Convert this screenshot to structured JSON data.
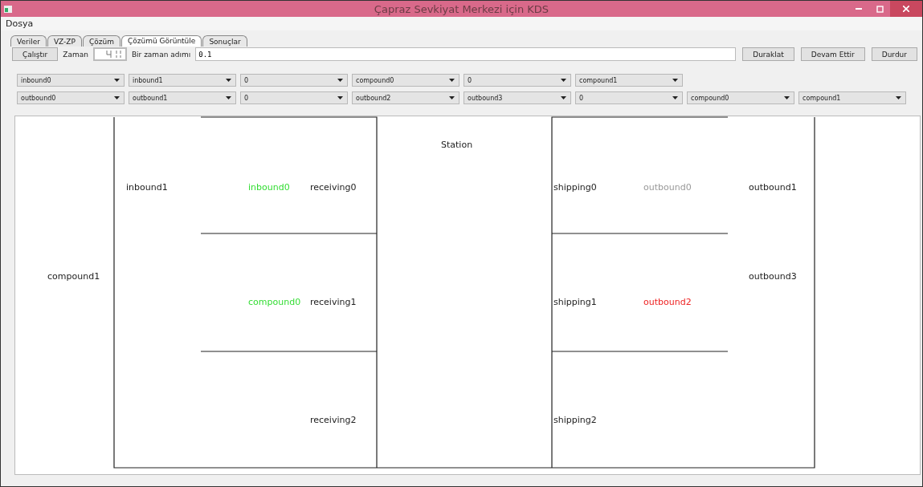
{
  "window": {
    "title": "Çapraz Sevkiyat Merkezi için KDS"
  },
  "menu": [
    "Dosya"
  ],
  "tabs": [
    {
      "label": "Veriler",
      "selected": false
    },
    {
      "label": "VZ-ZP",
      "selected": false
    },
    {
      "label": "Çözüm",
      "selected": false
    },
    {
      "label": "Çözümü Görüntüle",
      "selected": true
    },
    {
      "label": "Sonuçlar",
      "selected": false
    }
  ],
  "controls": {
    "run_button": "Çalıştır",
    "time_label": "Zaman",
    "step_label": "Bir zaman adımı",
    "step_value": "0.1",
    "buttons": [
      "Duraklat",
      "Devam Ettir",
      "Durdur"
    ]
  },
  "dropdown_rows": [
    [
      "inbound0",
      "inbound1",
      "0",
      "compound0",
      "0",
      "compound1"
    ],
    [
      "outbound0",
      "outbound1",
      "0",
      "outbound2",
      "outbound3",
      "0",
      "compound0",
      "compound1"
    ]
  ],
  "diagram": {
    "waiting_label": "compound1",
    "inbound_label": "inbound1",
    "station_label": "Station",
    "receiving_doors": [
      {
        "name": "receiving0",
        "truck": "inbound0",
        "color": "#33dd33"
      },
      {
        "name": "receiving1",
        "truck": "compound0",
        "color": "#33dd33"
      },
      {
        "name": "receiving2"
      }
    ],
    "shipping_doors": [
      {
        "name": "shipping0",
        "truck": "outbound0",
        "color": "#999999"
      },
      {
        "name": "shipping1",
        "truck": "outbound2",
        "color": "#ee2222"
      },
      {
        "name": "shipping2"
      }
    ],
    "outbound_labels": [
      "outbound1",
      "outbound3"
    ]
  }
}
